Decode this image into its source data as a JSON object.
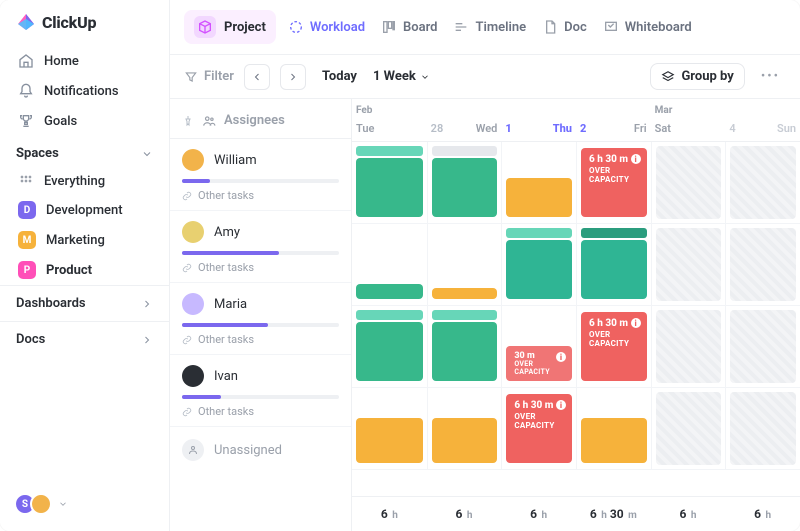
{
  "brand": {
    "name": "ClickUp"
  },
  "sidebar": {
    "nav": [
      {
        "label": "Home",
        "icon": "home-icon"
      },
      {
        "label": "Notifications",
        "icon": "bell-icon"
      },
      {
        "label": "Goals",
        "icon": "trophy-icon"
      }
    ],
    "spaces_title": "Spaces",
    "everything_label": "Everything",
    "items": [
      {
        "label": "Development",
        "letter": "D",
        "color": "#7b68ee"
      },
      {
        "label": "Marketing",
        "letter": "M",
        "color": "#f6b23b"
      },
      {
        "label": "Product",
        "letter": "P",
        "color": "#ff4fb8",
        "active": true
      }
    ],
    "dashboards_label": "Dashboards",
    "docs_label": "Docs",
    "footer_avatars": [
      {
        "bg": "#7b68ee",
        "text": "S"
      },
      {
        "bg": "#f2b34a",
        "text": ""
      }
    ]
  },
  "header": {
    "project_label": "Project"
  },
  "views": [
    {
      "label": "Workload",
      "icon": "workload-icon",
      "active": true
    },
    {
      "label": "Board",
      "icon": "board-icon"
    },
    {
      "label": "Timeline",
      "icon": "timeline-icon"
    },
    {
      "label": "Doc",
      "icon": "doc-icon"
    },
    {
      "label": "Whiteboard",
      "icon": "whiteboard-icon"
    }
  ],
  "toolbar": {
    "filter_label": "Filter",
    "today_label": "Today",
    "range_label": "1 Week",
    "groupby_label": "Group by"
  },
  "workload": {
    "assignees_title": "Assignees",
    "other_tasks_label": "Other tasks",
    "unassigned_label": "Unassigned",
    "month_labels": [
      "Feb",
      "",
      "",
      "",
      "Mar",
      ""
    ],
    "days": [
      {
        "name": "Tue",
        "num": ""
      },
      {
        "name": "Wed",
        "num": "28",
        "leading": true
      },
      {
        "name": "Thu",
        "num": "1",
        "highlight": true
      },
      {
        "name": "Fri",
        "num": "2",
        "highlight_num": true
      },
      {
        "name": "Sat",
        "num": ""
      },
      {
        "name": "Sun",
        "num": "4",
        "weekend": true
      }
    ],
    "assignees": [
      {
        "name": "William",
        "avatar_bg": "#f2b34a",
        "progress": 18
      },
      {
        "name": "Amy",
        "avatar_bg": "#e8d070",
        "progress": 62
      },
      {
        "name": "Maria",
        "avatar_bg": "#c7b9ff",
        "progress": 55
      },
      {
        "name": "Ivan",
        "avatar_bg": "#2a2e34",
        "progress": 25
      }
    ],
    "overcap_label": "OVER CAPACITY",
    "overcap_time_long": "6 h 30 m",
    "overcap_time_short": "30 m",
    "footer": [
      "6",
      "6",
      "6",
      "6  30",
      "6",
      "6"
    ]
  },
  "colors": {
    "accent": "#7b68ee",
    "green": "#37b88b",
    "mint": "#67d6b8",
    "orange": "#f6b23b",
    "red": "#ef6260"
  }
}
